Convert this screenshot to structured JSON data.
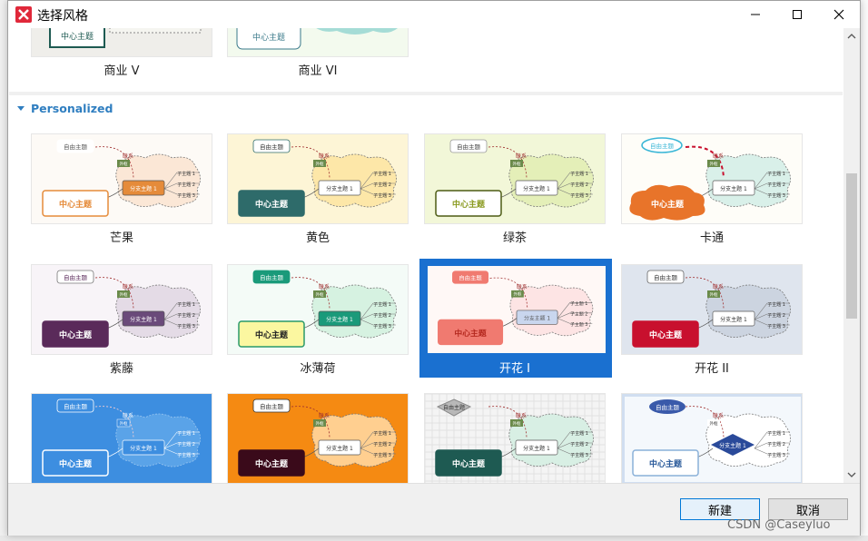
{
  "window": {
    "title": "选择风格"
  },
  "section": {
    "title": "Personalized"
  },
  "top_row": [
    {
      "name": "商业 V"
    },
    {
      "name": "商业 VI"
    }
  ],
  "themes": [
    {
      "name": "芒果",
      "center": "中心主题",
      "branch": "分支主题 1",
      "free": "自由主题"
    },
    {
      "name": "黄色",
      "center": "中心主题",
      "branch": "分支主题 1",
      "free": "自由主题"
    },
    {
      "name": "绿茶",
      "center": "中心主题",
      "branch": "分支主题 1",
      "free": "自由主题"
    },
    {
      "name": "卡通",
      "center": "中心主题",
      "branch": "分支主题 1",
      "free": "自由主题"
    },
    {
      "name": "紫藤",
      "center": "中心主题",
      "branch": "分支主题 1",
      "free": "自由主题"
    },
    {
      "name": "冰薄荷",
      "center": "中心主题",
      "branch": "分支主题 1",
      "free": "自由主题"
    },
    {
      "name": "开花 I",
      "center": "中心主题",
      "branch": "分支主题 1",
      "free": "自由主题"
    },
    {
      "name": "开花 II",
      "center": "中心主题",
      "branch": "分支主题 1",
      "free": "自由主题"
    },
    {
      "name": "",
      "center": "中心主题",
      "branch": "分支主题 1",
      "free": "自由主题"
    },
    {
      "name": "",
      "center": "中心主题",
      "branch": "分支主题 1",
      "free": "自由主题"
    },
    {
      "name": "",
      "center": "中心主题",
      "branch": "分支主题 1",
      "free": "自由主题"
    },
    {
      "name": "",
      "center": "中心主题",
      "branch": "分支主题 1",
      "free": "自由主题"
    }
  ],
  "mini": {
    "sub1": "子主题 1",
    "sub2": "子主题 2",
    "sub3": "子主题 3",
    "rel": "联系",
    "note": "外框"
  },
  "buttons": {
    "ok": "新建",
    "cancel": "取消"
  },
  "watermark": "CSDN @Caseyluo",
  "colors": {
    "accent": "#1a70d0",
    "section": "#2f7ec0",
    "logo": "#e0283a"
  }
}
